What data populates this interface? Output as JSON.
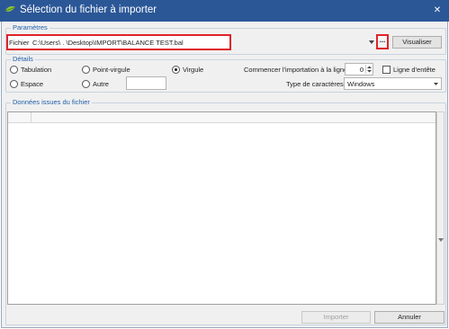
{
  "window": {
    "title": "Sélection du fichier à importer"
  },
  "parametres": {
    "legend": "Paramètres",
    "file_label": "Fichier",
    "file_path": "C:\\Users\\         .           \\Desktop\\IMPORT\\BALANCE TEST.bal",
    "browse_label": "...",
    "visualiser_label": "Visualiser"
  },
  "details": {
    "legend": "Détails",
    "separators": [
      {
        "label": "Tabulation",
        "selected": false
      },
      {
        "label": "Point-virgule",
        "selected": false
      },
      {
        "label": "Virgule",
        "selected": true
      },
      {
        "label": "Espace",
        "selected": false
      },
      {
        "label": "Autre",
        "selected": false
      }
    ],
    "start_line_label": "Commencer l'importation à la ligne",
    "start_line_value": "0",
    "header_line_label": "Ligne d'entête",
    "header_line_checked": false,
    "charset_label": "Type de caractères",
    "charset_value": "Windows"
  },
  "data_group": {
    "legend": "Données issues du fichier"
  },
  "footer": {
    "import_label": "Importer",
    "cancel_label": "Annuler"
  }
}
